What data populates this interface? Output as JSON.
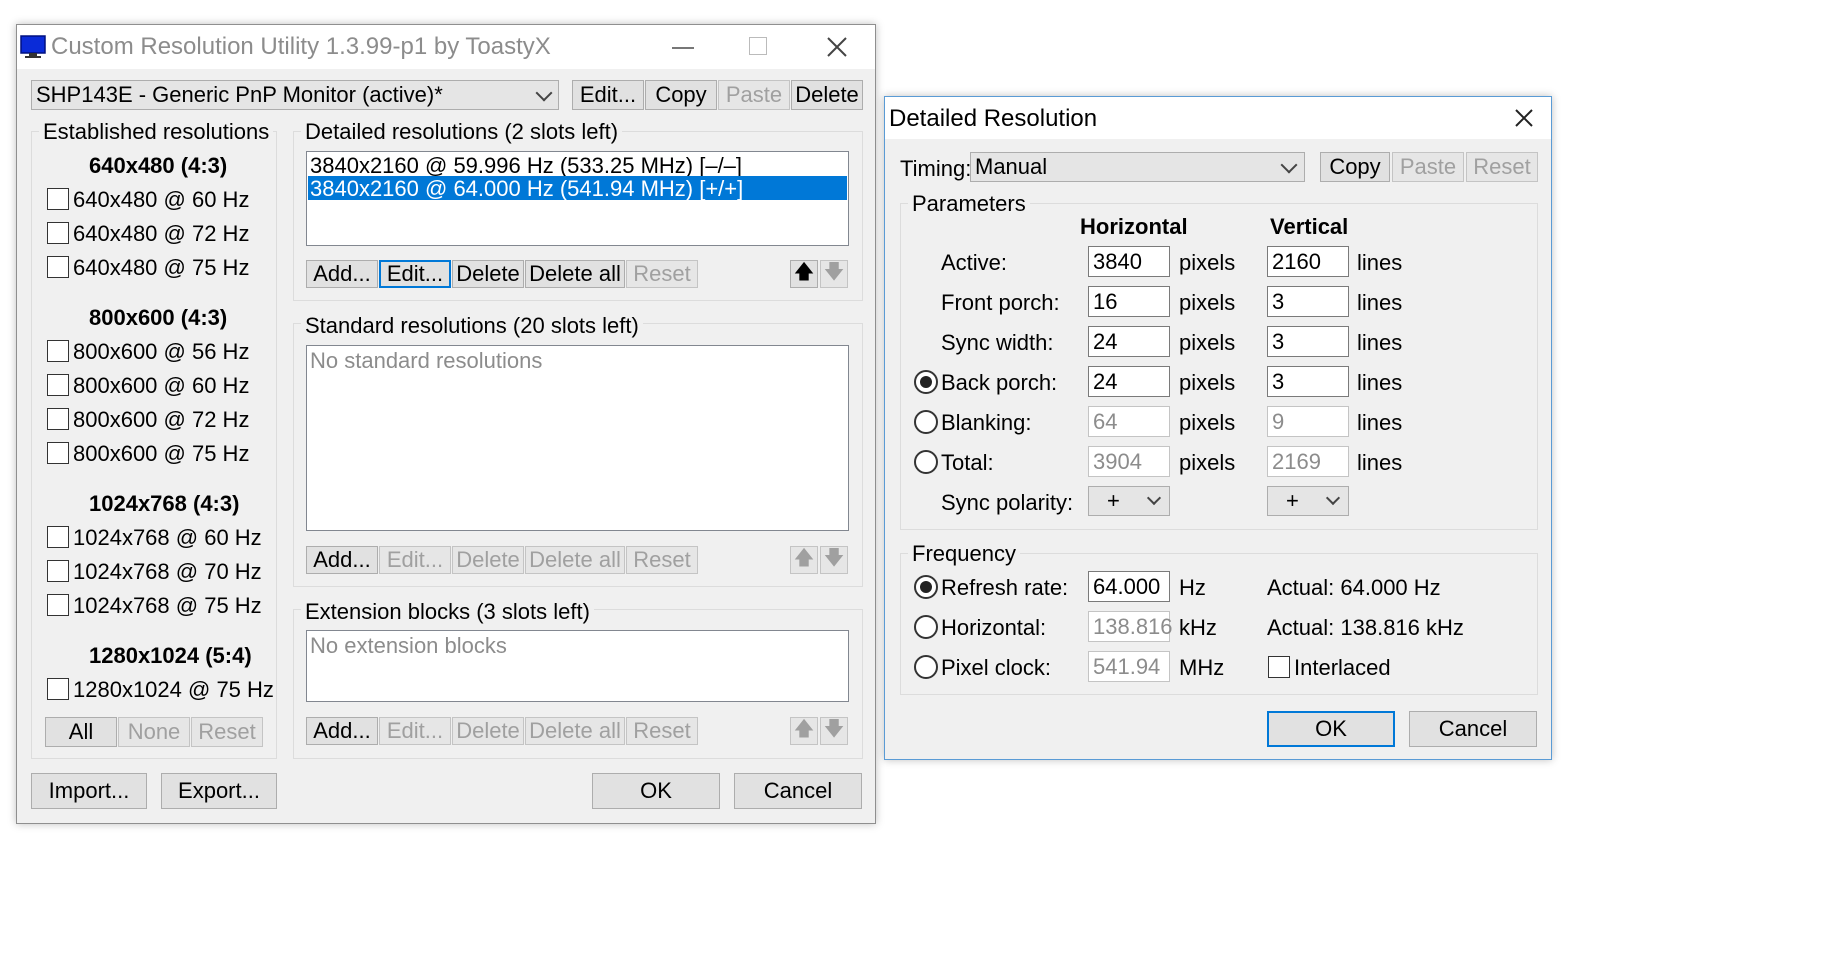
{
  "main": {
    "title": "Custom Resolution Utility 1.3.99-p1 by ToastyX",
    "monitor_value": "SHP143E - Generic PnP Monitor (active)*",
    "top_buttons": {
      "edit": "Edit...",
      "copy": "Copy",
      "paste": "Paste",
      "delete": "Delete"
    },
    "established": {
      "title": "Established resolutions",
      "groups": [
        {
          "header": "640x480 (4:3)",
          "items": [
            "640x480 @ 60 Hz",
            "640x480 @ 72 Hz",
            "640x480 @ 75 Hz"
          ]
        },
        {
          "header": "800x600 (4:3)",
          "items": [
            "800x600 @ 56 Hz",
            "800x600 @ 60 Hz",
            "800x600 @ 72 Hz",
            "800x600 @ 75 Hz"
          ]
        },
        {
          "header": "1024x768 (4:3)",
          "items": [
            "1024x768 @ 60 Hz",
            "1024x768 @ 70 Hz",
            "1024x768 @ 75 Hz"
          ]
        },
        {
          "header": "1280x1024 (5:4)",
          "items": [
            "1280x1024 @ 75 Hz"
          ]
        }
      ],
      "buttons": {
        "all": "All",
        "none": "None",
        "reset": "Reset"
      }
    },
    "detailed": {
      "title": "Detailed resolutions (2 slots left)",
      "items": [
        "3840x2160 @ 59.996 Hz (533.25 MHz) [–/–]",
        "3840x2160 @ 64.000 Hz (541.94 MHz) [+/+]"
      ],
      "buttons": {
        "add": "Add...",
        "edit": "Edit...",
        "delete": "Delete",
        "delete_all": "Delete all",
        "reset": "Reset"
      }
    },
    "standard": {
      "title": "Standard resolutions (20 slots left)",
      "empty": "No standard resolutions",
      "buttons": {
        "add": "Add...",
        "edit": "Edit...",
        "delete": "Delete",
        "delete_all": "Delete all",
        "reset": "Reset"
      }
    },
    "extension": {
      "title": "Extension blocks (3 slots left)",
      "empty": "No extension blocks",
      "buttons": {
        "add": "Add...",
        "edit": "Edit...",
        "delete": "Delete",
        "delete_all": "Delete all",
        "reset": "Reset"
      }
    },
    "bottom": {
      "import": "Import...",
      "export": "Export...",
      "ok": "OK",
      "cancel": "Cancel"
    }
  },
  "dialog": {
    "title": "Detailed Resolution",
    "timing_label": "Timing:",
    "timing_value": "Manual",
    "buttons": {
      "copy": "Copy",
      "paste": "Paste",
      "reset": "Reset"
    },
    "parameters": {
      "title": "Parameters",
      "horizontal": "Horizontal",
      "vertical": "Vertical",
      "rows": [
        {
          "label": "Active:",
          "h": "3840",
          "v": "2160",
          "hunit": "pixels",
          "vunit": "lines"
        },
        {
          "label": "Front porch:",
          "h": "16",
          "v": "3",
          "hunit": "pixels",
          "vunit": "lines"
        },
        {
          "label": "Sync width:",
          "h": "24",
          "v": "3",
          "hunit": "pixels",
          "vunit": "lines"
        },
        {
          "label": "Back porch:",
          "h": "24",
          "v": "3",
          "hunit": "pixels",
          "vunit": "lines"
        },
        {
          "label": "Blanking:",
          "h": "64",
          "v": "9",
          "hunit": "pixels",
          "vunit": "lines"
        },
        {
          "label": "Total:",
          "h": "3904",
          "v": "2169",
          "hunit": "pixels",
          "vunit": "lines"
        }
      ],
      "sync_label": "Sync polarity:",
      "sync_h": "+",
      "sync_v": "+"
    },
    "frequency": {
      "title": "Frequency",
      "refresh_label": "Refresh rate:",
      "refresh_value": "64.000",
      "refresh_unit": "Hz",
      "refresh_actual": "Actual: 64.000 Hz",
      "horizontal_label": "Horizontal:",
      "horizontal_value": "138.816",
      "horizontal_unit": "kHz",
      "horizontal_actual": "Actual: 138.816 kHz",
      "pixel_label": "Pixel clock:",
      "pixel_value": "541.94",
      "pixel_unit": "MHz",
      "interlaced": "Interlaced"
    },
    "ok": "OK",
    "cancel": "Cancel"
  }
}
